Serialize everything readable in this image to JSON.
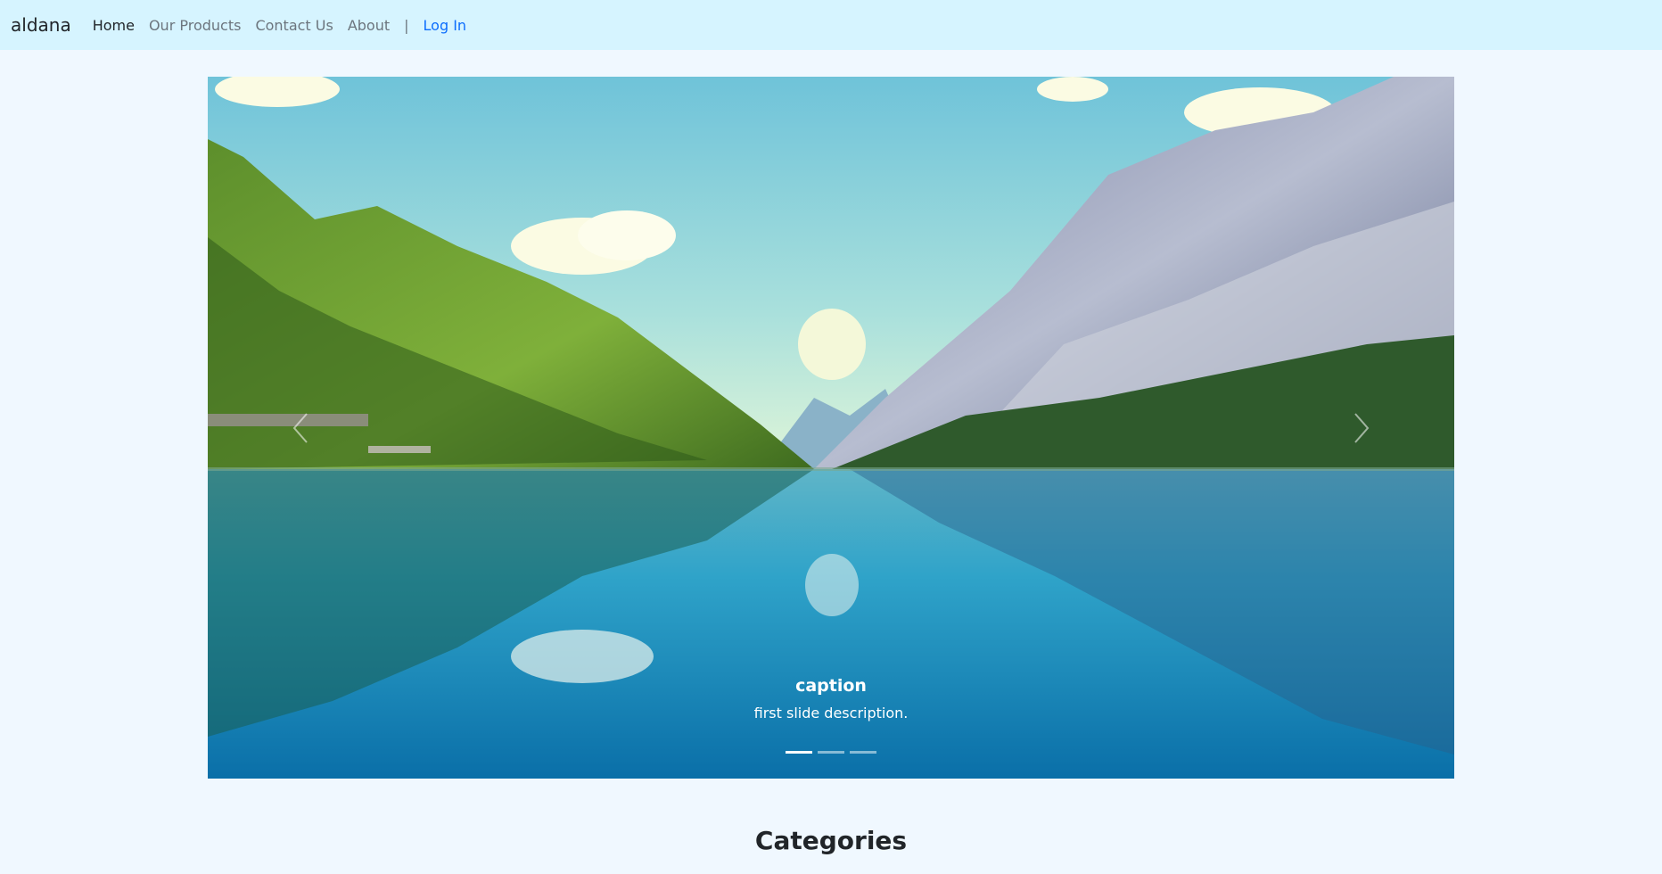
{
  "navbar": {
    "brand": "aldana",
    "links": [
      "Home",
      "Our Products",
      "Contact Us",
      "About"
    ],
    "separator": "|",
    "login": "Log In",
    "background": "#d6f4ff",
    "link_active_color": "#212529",
    "link_color": "#6c757d",
    "login_color": "#0d6efd"
  },
  "carousel": {
    "caption_title": "caption",
    "caption_text": "first slide description.",
    "indicator_count": 3,
    "active_indicator": 1,
    "prev_icon": "chevron-left-icon",
    "next_icon": "chevron-right-icon"
  },
  "section": {
    "title": "Categories"
  },
  "page": {
    "background": "#f0f8ff"
  }
}
